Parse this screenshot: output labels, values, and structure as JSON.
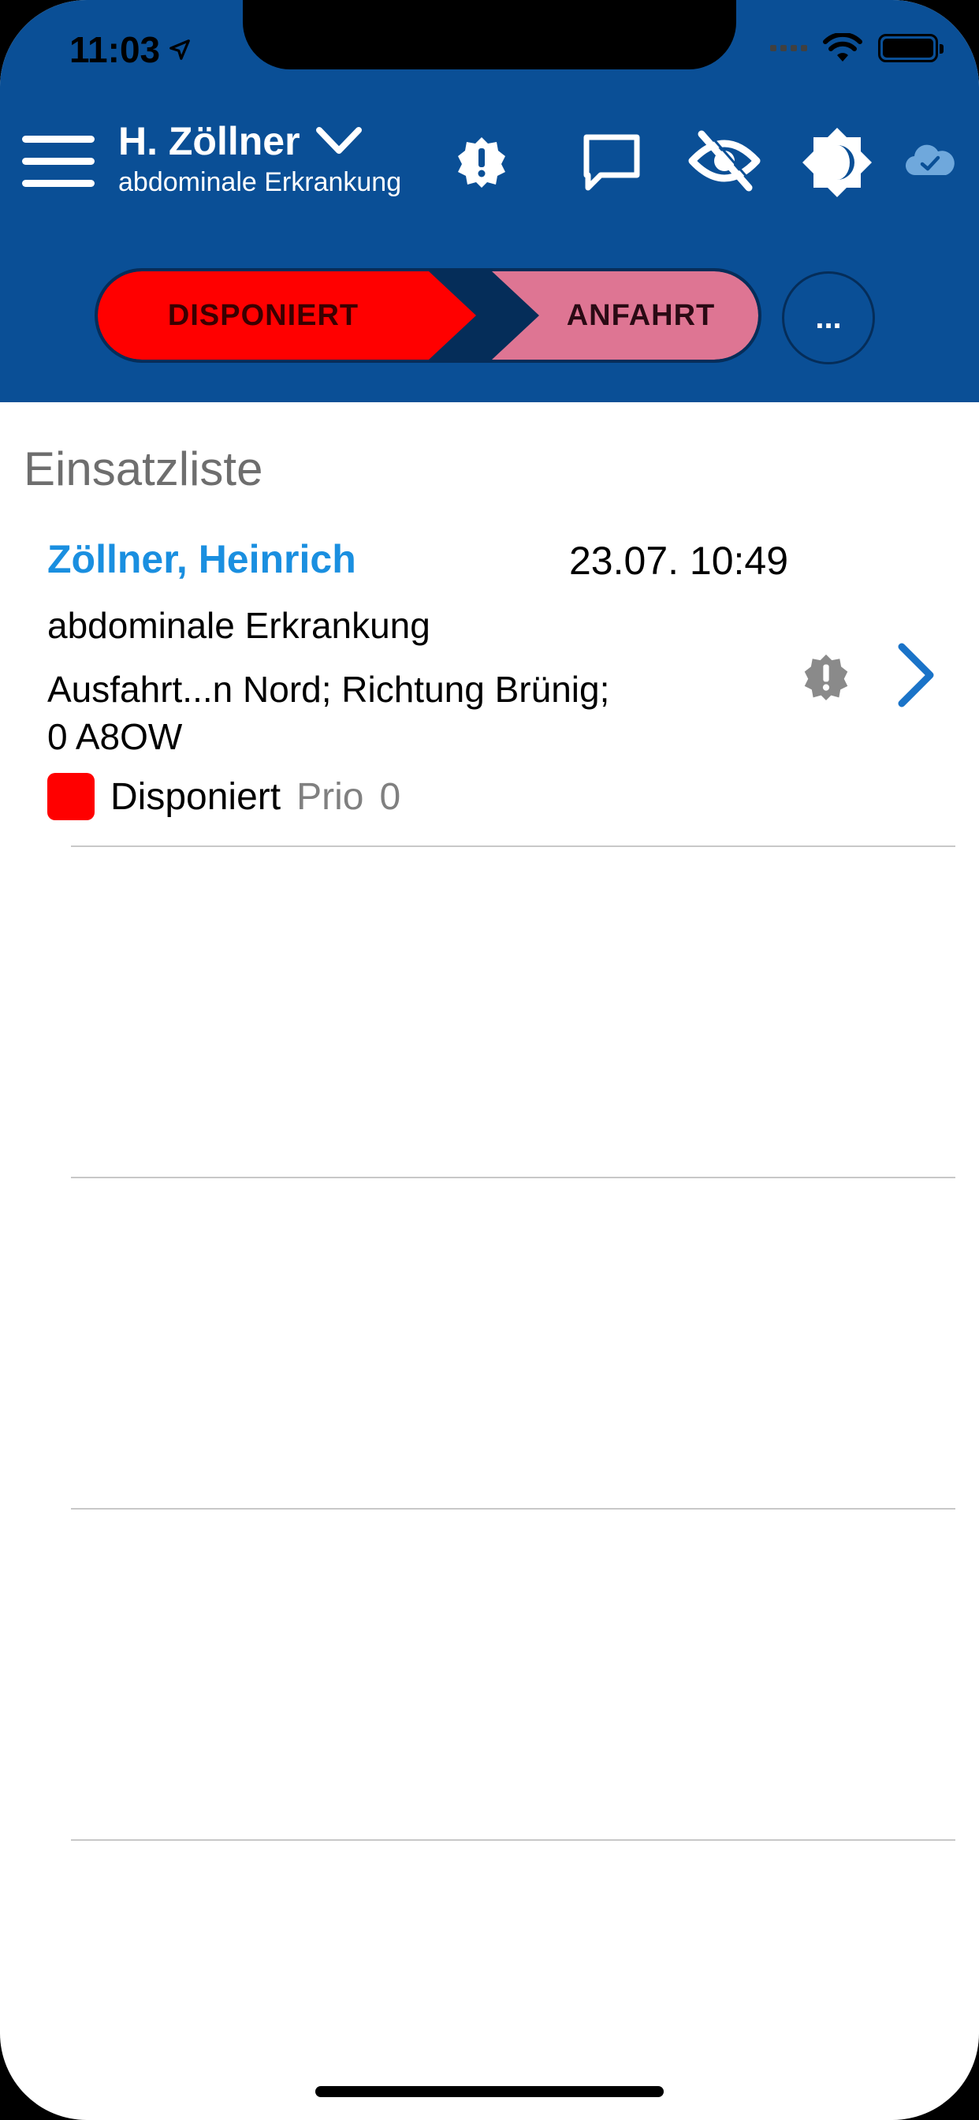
{
  "status_bar": {
    "time": "11:03"
  },
  "header": {
    "user_name": "H. Zöllner",
    "subtitle": "abdominale Erkrankung",
    "icons": [
      "menu-icon",
      "chevron-down-icon",
      "alert-badge-icon",
      "chat-icon",
      "eye-off-icon",
      "brightness-icon",
      "cloud-check-icon"
    ]
  },
  "status_flow": {
    "current": "DISPONIERT",
    "next": "ANFAHRT",
    "more_label": "..."
  },
  "list": {
    "title": "Einsatzliste",
    "items": [
      {
        "name": "Zöllner, Heinrich",
        "datetime": "23.07. 10:49",
        "diagnosis": "abdominale Erkrankung",
        "address_line1": "Ausfahrt...n Nord; Richtung Brünig;",
        "address_line2": "0 A8OW",
        "status": "Disponiert",
        "prio_label": "Prio",
        "prio_value": "0"
      }
    ]
  },
  "colors": {
    "header_bg": "#0a4f96",
    "disponiert": "#ff0000",
    "anfahrt": "#de7593",
    "link_blue": "#1a8fe0"
  }
}
